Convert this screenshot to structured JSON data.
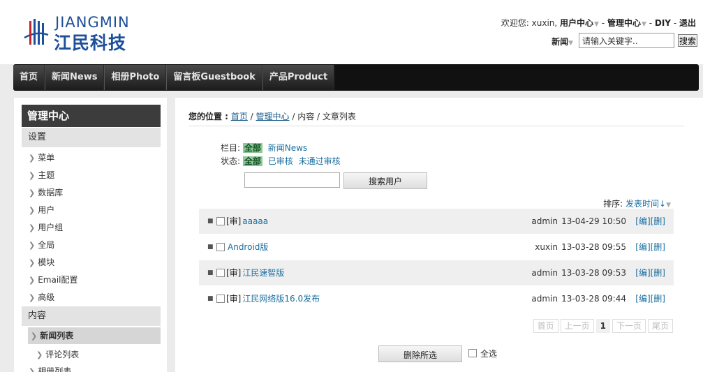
{
  "brand": {
    "name_en": "JIANGMIN",
    "name_cn": "江民科技",
    "color": "#1d4f9a"
  },
  "userbar": {
    "welcome": "欢迎您: xuxin,",
    "user_center": "用户中心",
    "sep1": " - ",
    "admin_center": "管理中心",
    "sep2": " - ",
    "diy": "DIY",
    "sep3": " - ",
    "logout": "退出"
  },
  "search": {
    "category": "新闻",
    "placeholder": "请输入关键字..",
    "value": "请输入关键字..",
    "button": "搜索"
  },
  "nav": [
    "首页",
    "新闻News",
    "相册Photo",
    "留言板Guestbook",
    "产品Product"
  ],
  "sidebar": {
    "title": "管理中心",
    "group_settings": "设置",
    "settings_items": [
      "菜单",
      "主题",
      "数据库",
      "用户",
      "用户组",
      "全局",
      "模块",
      "Email配置",
      "高级"
    ],
    "group_content": "内容",
    "content_active": "新闻列表",
    "content_items": [
      "评论列表",
      "相册列表"
    ]
  },
  "breadcrumb": {
    "label": "您的位置 :",
    "home": "首页",
    "admin": "管理中心",
    "content": "内容",
    "current": "文章列表",
    "sep": " / "
  },
  "filters": {
    "column_label": "栏目:",
    "column_selected": "全部",
    "column_options": [
      "新闻News"
    ],
    "status_label": "状态:",
    "status_selected": "全部",
    "status_options": [
      "已审核",
      "未通过审核"
    ]
  },
  "user_search": {
    "value": "",
    "button": "搜索用户"
  },
  "sort": {
    "label": "排序:",
    "value": "发表时间↓"
  },
  "articles": [
    {
      "tag": "[审]",
      "title": "aaaaa",
      "author": "admin",
      "date": "13-04-29 10:50",
      "ops": "[编][删]"
    },
    {
      "tag": "",
      "title": "Android版",
      "author": "xuxin",
      "date": "13-03-28 09:55",
      "ops": "[编][删]"
    },
    {
      "tag": "[审]",
      "title": "江民速智版",
      "author": "admin",
      "date": "13-03-28 09:53",
      "ops": "[编][删]"
    },
    {
      "tag": "[审]",
      "title": "江民网络版16.0发布",
      "author": "admin",
      "date": "13-03-28 09:44",
      "ops": "[编][删]"
    }
  ],
  "pager": {
    "first": "首页",
    "prev": "上一页",
    "current": "1",
    "next": "下一页",
    "last": "尾页"
  },
  "bulk": {
    "delete_button": "删除所选",
    "select_all": "全选"
  }
}
